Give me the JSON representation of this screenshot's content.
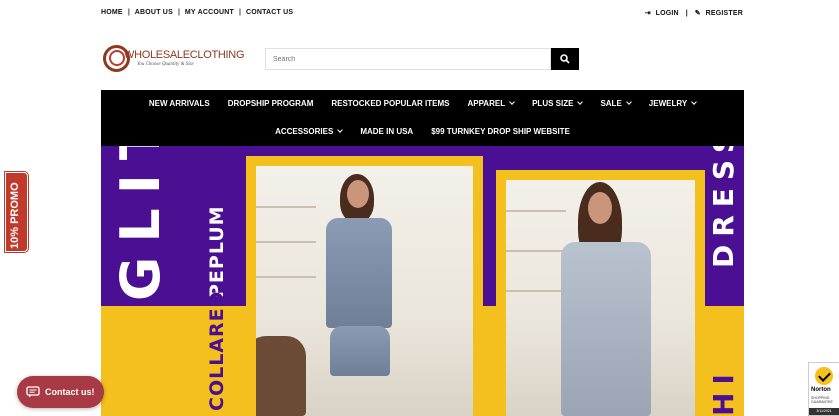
{
  "topbar": {
    "links": [
      "HOME",
      "ABOUT US",
      "MY ACCOUNT",
      "CONTACT US"
    ],
    "login": "LOGIN",
    "register": "REGISTER"
  },
  "logo": {
    "text": "WHOLESALECLOTHING",
    "tagline": "You Choose Quantity & Size"
  },
  "search": {
    "placeholder": "Search"
  },
  "nav": {
    "row1": [
      {
        "label": "NEW ARRIVALS",
        "dropdown": false
      },
      {
        "label": "DROPSHIP PROGRAM",
        "dropdown": false
      },
      {
        "label": "RESTOCKED POPULAR ITEMS",
        "dropdown": false
      },
      {
        "label": "APPAREL",
        "dropdown": true
      },
      {
        "label": "PLUS SIZE",
        "dropdown": true
      },
      {
        "label": "SALE",
        "dropdown": true
      },
      {
        "label": "JEWELRY",
        "dropdown": true
      }
    ],
    "row2": [
      {
        "label": "ACCESSORIES",
        "dropdown": true
      },
      {
        "label": "MADE IN USA",
        "dropdown": false
      },
      {
        "label": "$99 TURNKEY DROP SHIP WEBSITE",
        "dropdown": false
      }
    ]
  },
  "banner": {
    "glitter": "GLITTER",
    "peplum": "PEPLUM",
    "collared": "COLLARED",
    "dress": "DRESS",
    "hi": "HI",
    "colors": {
      "purple": "#4b0f93",
      "yellow": "#f4c01d"
    }
  },
  "promo": {
    "label": "10% PROMO"
  },
  "contact": {
    "label": "Contact us!"
  },
  "norton": {
    "name": "Norton",
    "sub": "SHOPPING GUARANTEE",
    "date": "3/11/2021"
  }
}
